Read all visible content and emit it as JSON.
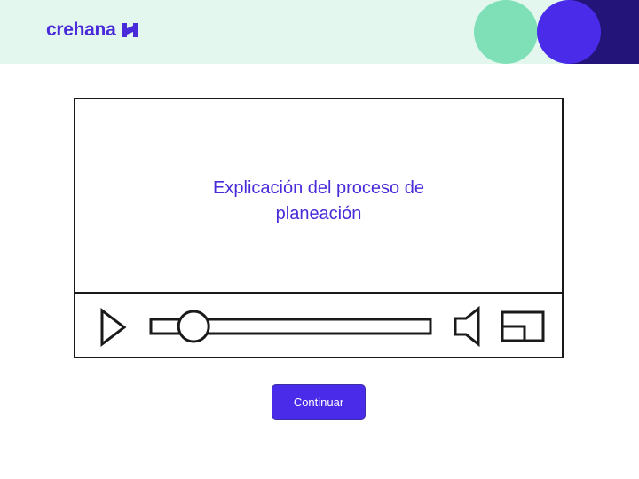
{
  "header": {
    "logo_text": "crehana",
    "logo_icon": "crehana-mark-icon"
  },
  "video": {
    "title": "Explicación del proceso de planeación",
    "progress": 0.12,
    "icons": [
      "play-icon",
      "volume-icon",
      "fullscreen-icon"
    ]
  },
  "actions": {
    "continue_label": "Continuar"
  },
  "colors": {
    "brand": "#4a2bd9",
    "header_bg": "#e3f7ee",
    "accent_green": "#7fe0b8",
    "accent_purple": "#4a2bea",
    "accent_dark": "#221479"
  }
}
